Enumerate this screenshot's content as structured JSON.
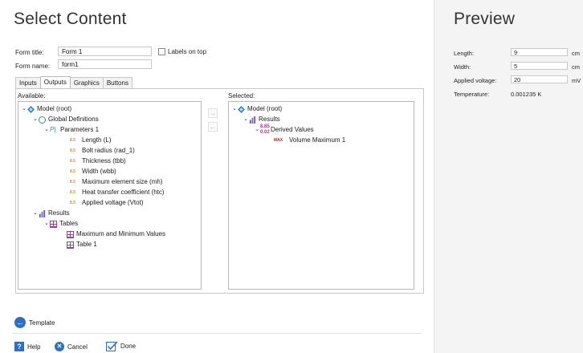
{
  "left": {
    "title": "Select Content",
    "form_title_label": "Form title:",
    "form_title_value": "Form 1",
    "labels_on_top": "Labels on top",
    "form_name_label": "Form name:",
    "form_name_value": "form1",
    "tabs": [
      "Inputs",
      "Outputs",
      "Graphics",
      "Buttons"
    ],
    "active_tab": "Outputs",
    "available_label": "Available:",
    "selected_label": "Selected:",
    "available_tree": {
      "model": "Model (root)",
      "global_defs": "Global Definitions",
      "parameters": "Parameters 1",
      "params": [
        "Length (L)",
        "Bolt radius (rad_1)",
        "Thickness (tbb)",
        "Width (wbb)",
        "Maximum element size (mh)",
        "Heat transfer coefficient (htc)",
        "Applied voltage (Vtot)"
      ],
      "param_icon_text": "8.5",
      "results": "Results",
      "tables": "Tables",
      "table_items": [
        "Maximum and Minimum Values",
        "Table 1"
      ]
    },
    "selected_tree": {
      "model": "Model (root)",
      "results": "Results",
      "derived": "Derived Values",
      "derived_icon_text": "8.85\n0.02",
      "vol_max_icon_text": "MAX",
      "vol_max": "Volume Maximum 1"
    },
    "template_button": "Template",
    "help_button": "Help",
    "cancel_button": "Cancel",
    "done_button": "Done"
  },
  "preview": {
    "title": "Preview",
    "rows": [
      {
        "label": "Length:",
        "value": "9",
        "unit": "cm"
      },
      {
        "label": "Width:",
        "value": "5",
        "unit": "cm"
      },
      {
        "label": "Applied voltage:",
        "value": "20",
        "unit": "mV"
      }
    ],
    "temp_label": "Temperature:",
    "temp_value": "0.001235 K"
  },
  "colors": {
    "accent_blue": "#3c7fc7",
    "table_purple": "#9b3f9b",
    "param_orange": "#e08a2b",
    "max_red": "#c02626"
  }
}
